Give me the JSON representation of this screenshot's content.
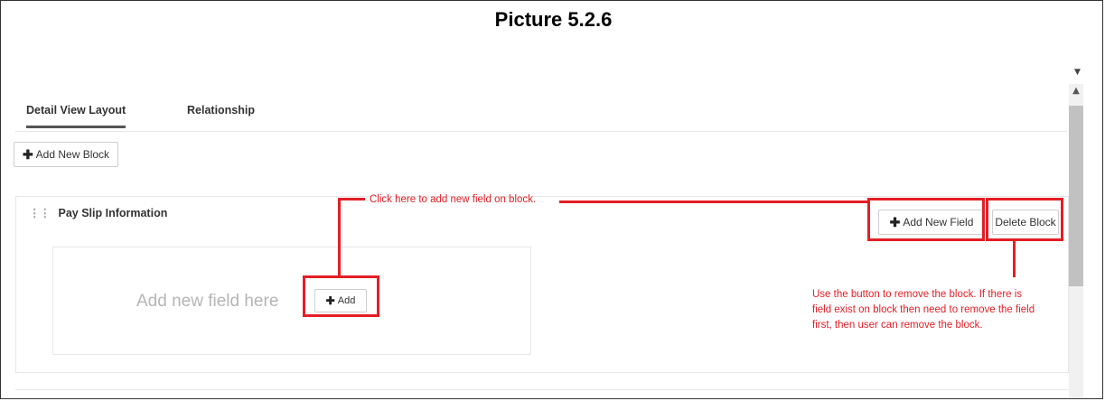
{
  "document": {
    "title": "Picture 5.2.6"
  },
  "tabs": [
    {
      "label": "Detail View Layout",
      "active": true
    },
    {
      "label": "Relationship",
      "active": false
    }
  ],
  "toolbar": {
    "add_block_label": "Add New Block"
  },
  "block": {
    "title": "Pay Slip Information",
    "add_field_label": "Add New Field",
    "delete_label": "Delete Block",
    "placeholder": "Add new field here",
    "add_label": "Add"
  },
  "annotations": {
    "add_field_note": "Click here to add new field on block.",
    "delete_note_lines": [
      "Use the button to remove the block. If there is",
      "field exist on block then need to remove the field",
      "first, then user can remove the block."
    ]
  },
  "colors": {
    "annotation_red": "#e41e26"
  },
  "icons": {
    "plus": "plus-icon",
    "drag": "drag-handle-icon",
    "scroll_up": "chevron-up-icon",
    "scroll_down": "chevron-down-icon"
  }
}
